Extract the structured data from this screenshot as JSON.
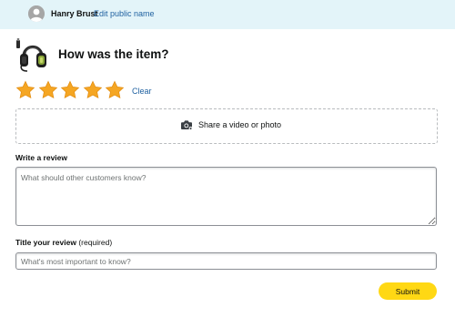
{
  "header": {
    "user_name": "Hanry Brust",
    "edit_link": "Edit public name",
    "avatar_icon": "user-silhouette-icon",
    "background_color": "#e3f4f9"
  },
  "product": {
    "image_icon": "headset-product-image"
  },
  "rating": {
    "heading": "How was the item?",
    "star_count": 5,
    "selected": 5,
    "star_color": "#f5a623",
    "clear_label": "Clear"
  },
  "media": {
    "icon": "camera-icon",
    "label": "Share a video or photo"
  },
  "review": {
    "label": "Write a review",
    "placeholder": "What should other customers know?",
    "value": ""
  },
  "title": {
    "label": "Title your review",
    "required_text": "(required)",
    "placeholder": "What's most important to know?",
    "value": ""
  },
  "submit": {
    "label": "Submit",
    "color": "#ffd814"
  },
  "colors": {
    "link": "#2162a1",
    "text": "#0f1111"
  }
}
